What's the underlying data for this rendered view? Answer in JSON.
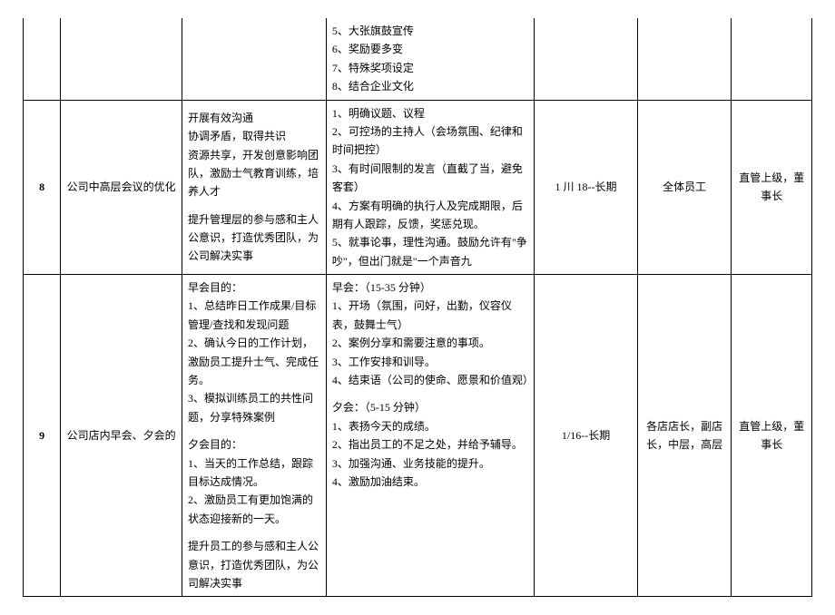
{
  "rows": [
    {
      "num": "",
      "topic": "",
      "objective": "",
      "detail": [
        "5、大张旗鼓宣传",
        "6、奖励要多变",
        "7、特殊奖项设定",
        "8、结合企业文化"
      ],
      "time": "",
      "responsible": "",
      "supervisor": ""
    },
    {
      "num": "8",
      "topic": "公司中高层会议的优化",
      "objective_lines": [
        "开展有效沟通",
        "协调矛盾，取得共识",
        "资源共享，开发创意影响团队，激励士气教育训练，培养人才",
        "",
        "提升管理层的参与感和主人公意识，打造优秀团队，为公司解决实事"
      ],
      "detail": [
        "1、明确议题、议程",
        "2、可控场的主持人（会场氛围、纪律和时间把控）",
        "3、有时间限制的发言（直截了当，避免客套）",
        "4、方案有明确的执行人及完成期限，后期有人跟踪，反馈，奖惩兑现。",
        "5、就事论事，理性沟通。鼓励允许有\"争吵\"，但出门就是\"一个声音九"
      ],
      "time": "1 川 18--长期",
      "responsible": "全体员工",
      "supervisor": "直管上级，董事长"
    },
    {
      "num": "9",
      "topic": "公司店内早会、夕会的",
      "morning_title": "早会目的：",
      "morning_obj": [
        "1、总结昨日工作成果/目标管理/查找和发现问题",
        "2、确认今日的工作计划，激励员工提升士气、完成任务。",
        "3、模拟训练员工的共性问题，分享特殊案例"
      ],
      "evening_title": "夕会目的：",
      "evening_obj": [
        "1、当天的工作总结，跟踪目标达成情况。",
        "2、激励员工有更加饱满的状态迎接新的一天。"
      ],
      "obj_footer": "提升员工的参与感和主人公意识，打造优秀团队，为公司解决实事",
      "detail_morning_title": "早会：（15-35 分钟）",
      "detail_morning": [
        "1、开场（氛围，问好，出勤，仪容仪表，鼓舞士气）",
        "2、案例分享和需要注意的事项。",
        "3、工作安排和训导。",
        "4、结束语（公司的使命、愿景和价值观）"
      ],
      "detail_evening_title": "夕会：（5-15 分钟）",
      "detail_evening": [
        "1、表扬今天的成绩。",
        "2、指出员工的不足之处，并给予辅导。",
        "3、加强沟通、业务技能的提升。",
        "4、激励加油结束。"
      ],
      "time": "1/16--长期",
      "responsible": "各店店长，副店长，中层，高层",
      "supervisor": "直管上级，董事长"
    }
  ]
}
